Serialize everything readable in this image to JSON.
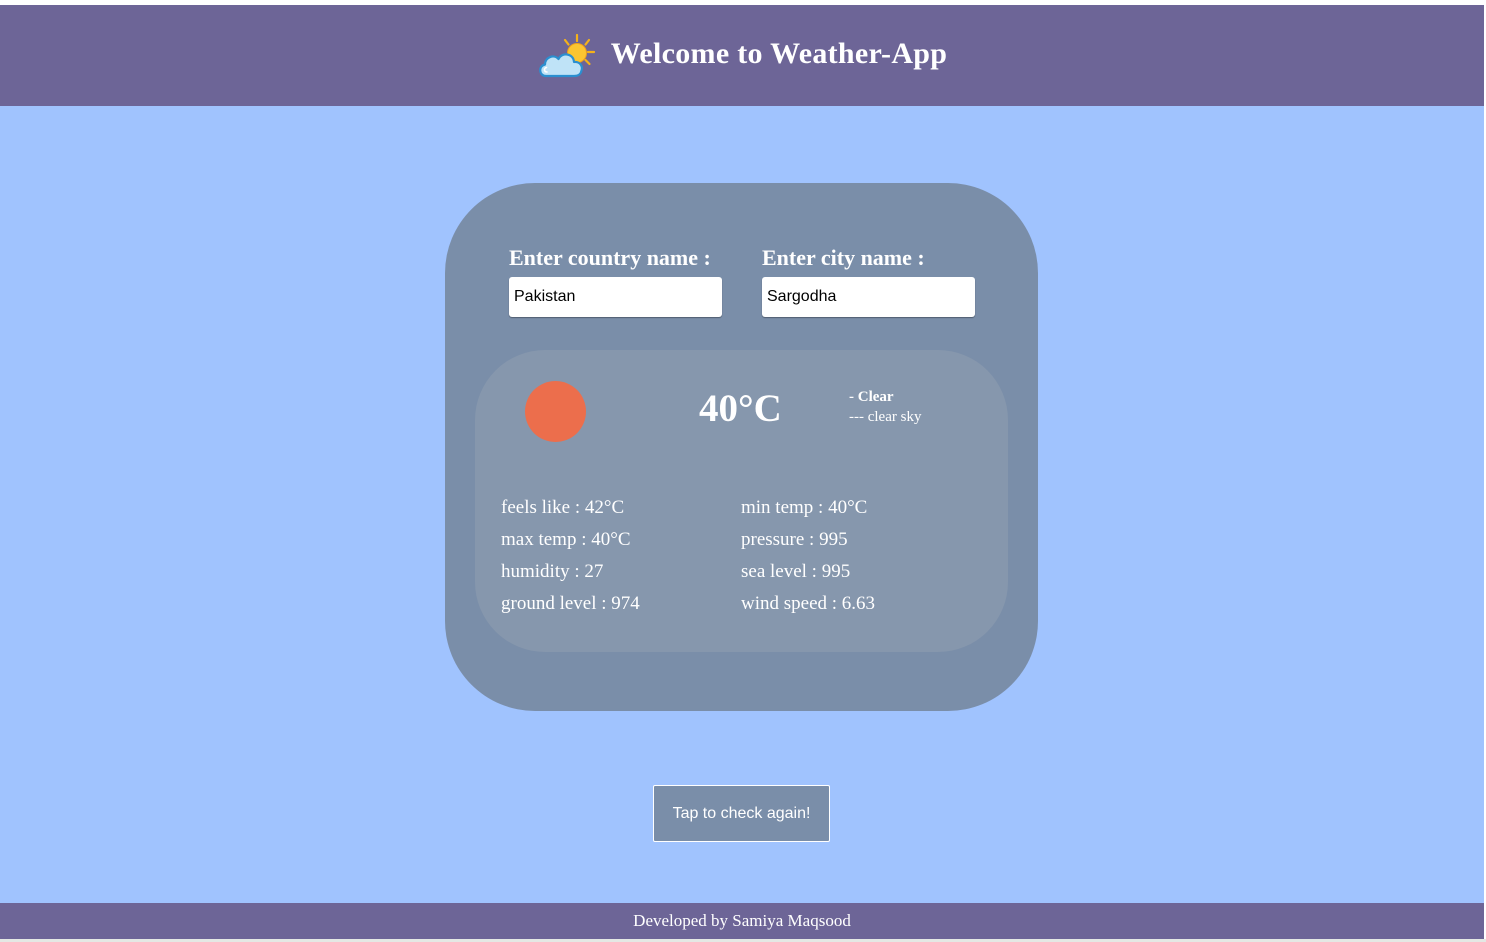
{
  "header": {
    "title": "Welcome to Weather-App",
    "logo_icon": "sun-behind-cloud-icon"
  },
  "form": {
    "country_label": "Enter country name :",
    "country_value": "Pakistan",
    "city_label": "Enter city name :",
    "city_value": "Sargodha"
  },
  "weather": {
    "icon": "weather-status-circle-icon",
    "icon_color": "#ec6e4c",
    "temperature": "40°C",
    "condition": "- Clear",
    "description": "--- clear sky",
    "details": {
      "feels_like": "feels like : 42°C",
      "min_temp": "min temp : 40°C",
      "max_temp": "max temp : 40°C",
      "pressure": "pressure : 995",
      "humidity": "humidity : 27",
      "sea_level": "sea level : 995",
      "ground_level": "ground level : 974",
      "wind_speed": "wind speed : 6.63"
    }
  },
  "actions": {
    "check_again_label": "Tap to check again!"
  },
  "footer": {
    "text": "Developed by Samiya Maqsood"
  },
  "colors": {
    "background": "#a0c3fe",
    "header_footer": "#6d6597",
    "card": "#7a8ea9",
    "inner_card": "#8697ad",
    "text": "#ffffff"
  }
}
